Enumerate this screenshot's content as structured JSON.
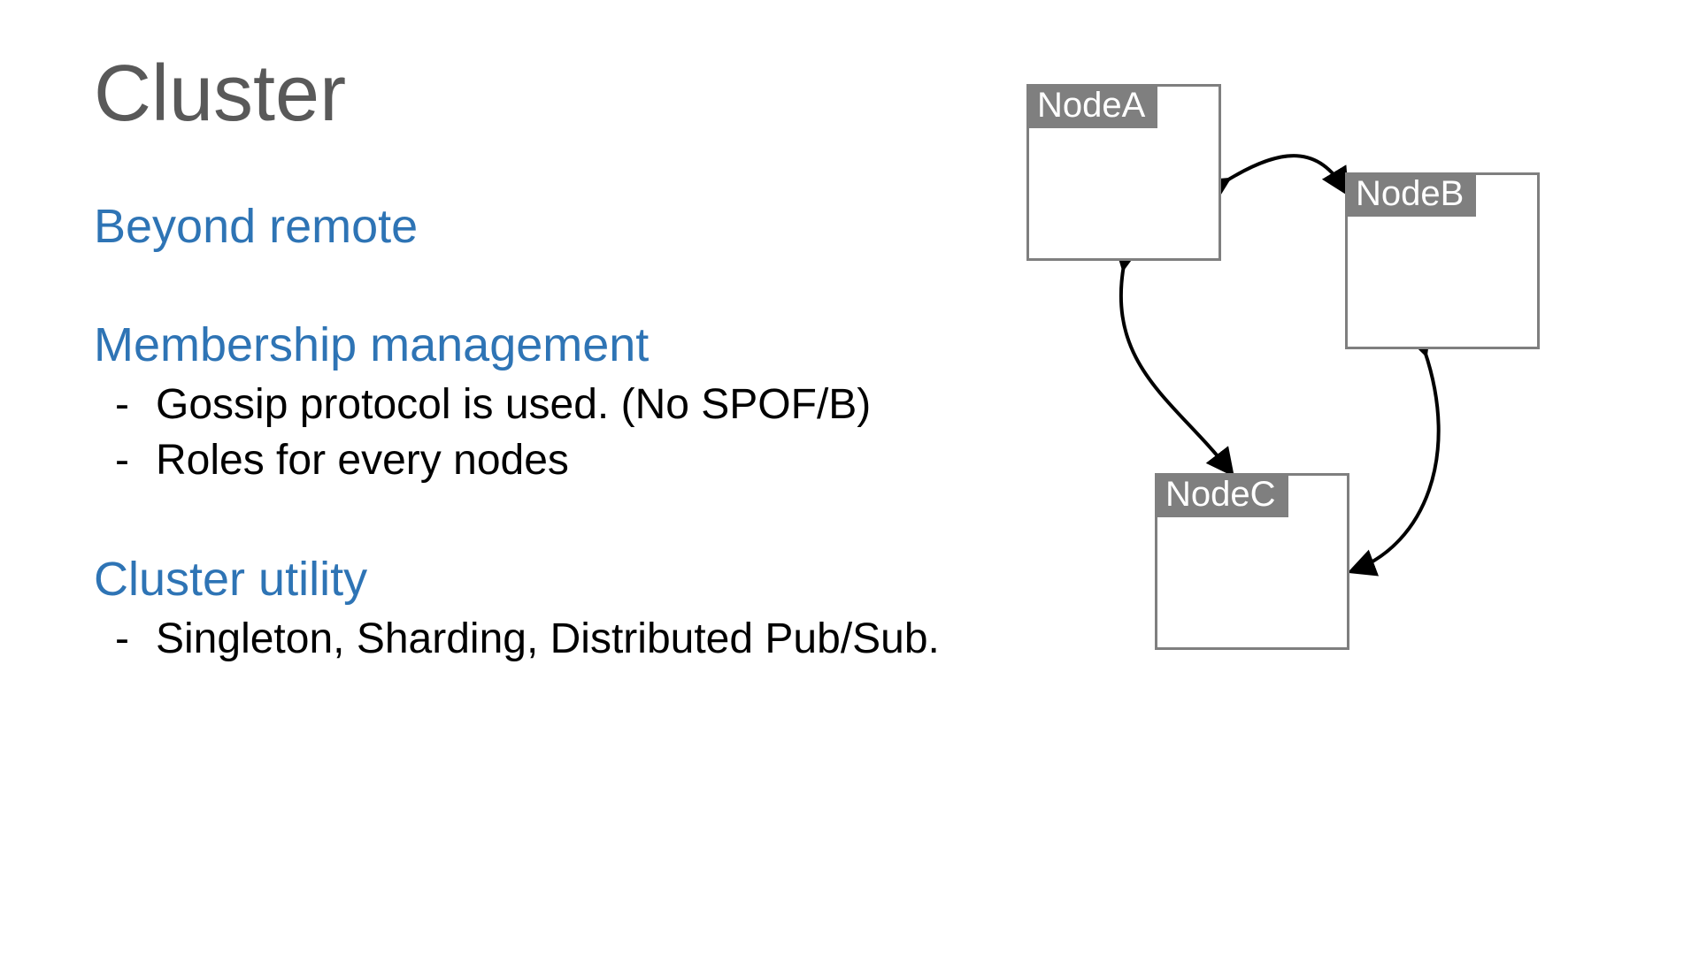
{
  "title": "Cluster",
  "sections": [
    {
      "heading": "Beyond remote",
      "bullets": []
    },
    {
      "heading": "Membership management",
      "bullets": [
        "Gossip protocol is used. (No SPOF/B)",
        "Roles for every nodes"
      ]
    },
    {
      "heading": "Cluster utility",
      "bullets": [
        "Singleton, Sharding, Distributed Pub/Sub."
      ]
    }
  ],
  "diagram": {
    "nodes": {
      "a": "NodeA",
      "b": "NodeB",
      "c": "NodeC"
    }
  },
  "colors": {
    "title": "#595959",
    "heading": "#2E74B5",
    "node_fill": "#7f7f7f"
  }
}
